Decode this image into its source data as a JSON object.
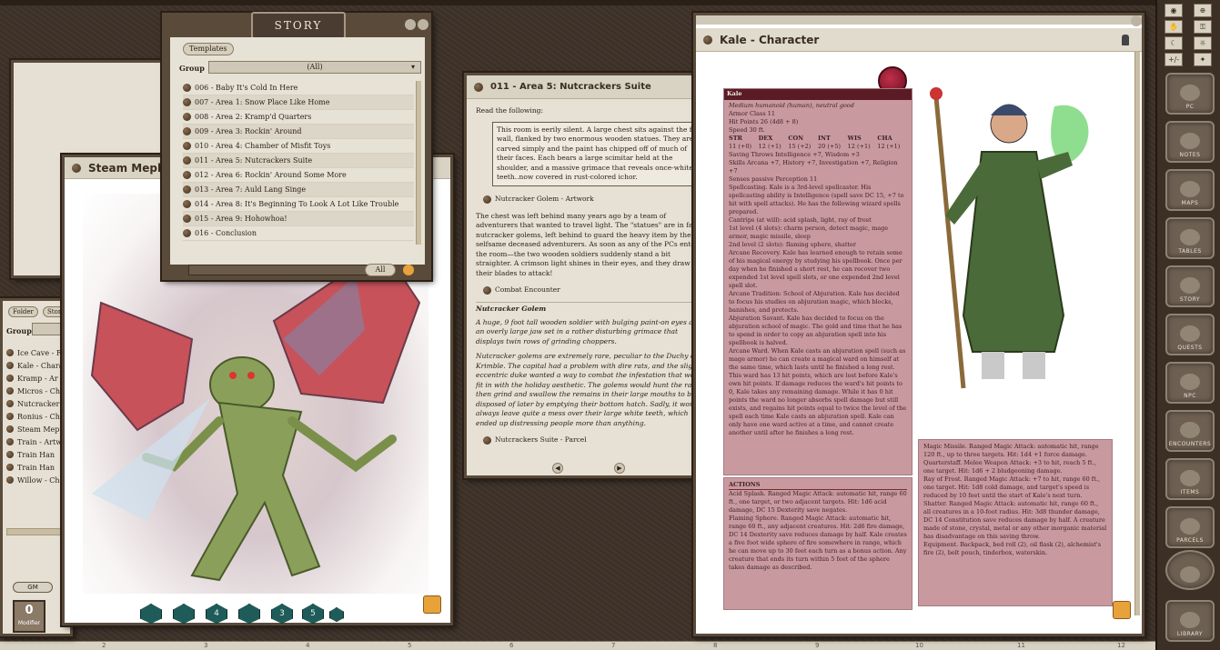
{
  "story": {
    "title": "STORY",
    "templates_label": "Templates",
    "group_label": "Group",
    "group_value": "(All)",
    "items": [
      "006 - Baby It's Cold In Here",
      "007 - Area 1: Snow Place Like Home",
      "008 - Area 2: Kramp'd Quarters",
      "009 - Area 3: Rockin' Around",
      "010 - Area 4: Chamber of Misfit Toys",
      "011 - Area 5: Nutcrackers Suite",
      "012 - Area 6: Rockin' Around Some More",
      "013 - Area 7: Auld Lang Singe",
      "014 - Area 8: It's Beginning To Look A Lot Like Trouble",
      "015 - Area 9: Hohowhoa!",
      "016 - Conclusion"
    ],
    "all_button": "All"
  },
  "mephit": {
    "title": "Steam Mephit"
  },
  "left_list": {
    "folder_tab": "Folder",
    "store_tab": "Store",
    "group_label": "Group",
    "items": [
      "Ice Cave - R",
      "Kale - Chara",
      "Kramp - Ar",
      "Micros - Ch",
      "Nutcracker",
      "Ronius - Ch",
      "Steam Mep",
      "Train - Artw",
      "Train Han",
      "Train Han",
      "Willow - Ch"
    ],
    "gm_label": "GM",
    "modifier_value": "0",
    "modifier_label": "Modifier"
  },
  "dice": [
    "",
    "",
    "4",
    "",
    "3",
    "5",
    ""
  ],
  "area5": {
    "title": "011 - Area 5: Nutcrackers Suite",
    "read": "Read the following:",
    "boxed": "This room is eerily silent. A large chest sits against the far wall, flanked by two enormous wooden statues. They are carved simply and the paint has chipped off of much of their faces. Each bears a large scimitar held at the shoulder, and a massive grimace that reveals once-white teeth..now covered in rust-colored ichor.",
    "link1": "Nutcracker Golem - Artwork",
    "para1": "The chest was left behind many years ago by a team of adventurers that wanted to travel light. The \"statues\" are in fact nutcracker golems, left behind to guard the heavy item by the selfsame deceased adventurers. As soon as any of the PCs enter the room—the two wooden soldiers suddenly stand a bit straighter. A crimson light shines in their eyes, and they draw their blades to attack!",
    "link2": "Combat Encounter",
    "heading": "Nutcracker Golem",
    "para2": "A huge, 9 foot tall wooden soldier with bulging paint-on eyes and an overly large jaw set in a rather disturbing grimace that displays twin rows of grinding choppers.",
    "para3": "Nutcracker golems are extremely rare, peculiar to the Duchy of Krimble. The capital had a problem with dire rats, and the slightly eccentric duke wanted a way to combat the infestation that would fit in with the holiday aesthetic. The golems would hunt the rats, then grind and swallow the remains in their large mouths to be disposed of later by emptying their bottom hatch. Sadly, it would always leave quite a mess over their large white teeth, which ended up distressing people more than anything.",
    "link3": "Nutcrackers Suite - Parcel"
  },
  "kale": {
    "title": "Kale - Character",
    "name": "Kale",
    "type": "Medium humanoid (human), neutral good",
    "ac": "Armor Class 11",
    "hp": "Hit Points 26 (4d8 + 8)",
    "speed": "Speed 30 ft.",
    "abilities": [
      "STR",
      "DEX",
      "CON",
      "INT",
      "WIS",
      "CHA"
    ],
    "scores": [
      "11 (+0)",
      "12 (+1)",
      "15 (+2)",
      "20 (+5)",
      "12 (+1)",
      "12 (+1)"
    ],
    "saves": "Saving Throws Intelligence +7, Wisdom +3",
    "skills": "Skills Arcana +7, History +7, Investigation +7, Religion +7",
    "senses": "Senses passive Perception 11",
    "spellcasting": "Spellcasting. Kale is a 3rd-level spellcaster. His spellcasting ability is Intelligence (spell save DC 15, +7 to hit with spell attacks). He has the following wizard spells prepared.",
    "cantrips": "Cantrips (at will): acid splash, light, ray of frost",
    "first": "1st level (4 slots): charm person, detect magic, mage armor, magic missile, sleep",
    "second": "2nd level (2 slots): flaming sphere, shatter",
    "recovery": "Arcane Recovery. Kale has learned enough to retain some of his magical energy by studying his spellbook. Once per day when he finished a short rest, he can recover two expended 1st level spell slots, or one expended 2nd level spell slot.",
    "tradition": "Arcane Tradition: School of Abjuration. Kale has decided to focus his studies on abjuration magic, which blocks, banishes, and protects.",
    "savant": "Abjuration Savant. Kale has decided to focus on the abjuration school of magic. The gold and time that he has to spend in order to copy an abjuration spell into his spellbook is halved.",
    "ward": "Arcane Ward. When Kale casts an abjuration spell (such as mage armor) he can create a magical ward on himself at the same time, which lasts until he finished a long rest. This ward has 13 hit points, which are lost before Kale's own hit points. If damage reduces the ward's hit points to 0, Kale takes any remaining damage. While it has 0 hit points the ward no longer absorbs spell damage but still exists, and regains hit points equal to twice the level of the spell each time Kale casts an abjuration spell. Kale can only have one ward active at a time, and cannot create another until after he finishes a long rest.",
    "actions": "ACTIONS",
    "acid": "Acid Splash. Ranged Magic Attack: automatic hit, range 60 ft., one target, or two adjacent targets. Hit: 1d6 acid damage, DC 15 Dexterity save negates.",
    "flaming": "Flaming Sphere. Ranged Magic Attack: automatic hit, range 60 ft., any adjacent creatures. Hit: 2d6 fire damage, DC 14 Dexterity save reduces damage by half. Kale creates a five foot wide sphere of fire somewhere in range, which he can move up to 30 feet each turn as a bonus action. Any creature that ends its turn within 5 feet of the sphere takes damage as described.",
    "missile": "Magic Missile. Ranged Magic Attack: automatic hit, range 120 ft., up to three targets. Hit: 1d4 +1 force damage.",
    "quarterstaff": "Quarterstaff. Melee Weapon Attack: +3 to hit, reach 5 ft., one target. Hit: 1d6 + 2 bludgeoning damage.",
    "frost": "Ray of Frost. Ranged Magic Attack: +7 to hit, range 60 ft., one target. Hit: 1d8 cold damage, and target's speed is reduced by 10 feet until the start of Kale's next turn.",
    "shatter": "Shatter. Ranged Magic Attack: automatic hit, range 60 ft., all creatures in a 10-foot radius. Hit: 3d8 thunder damage, DC 14 Constitution save reduces damage by half. A creature made of stone, crystal, metal or any other inorganic material has disadvantage on this saving throw.",
    "equipment": "Equipment. Backpack, bed roll (2), oil flask (2), alchemist's fire (2), belt pouch, tinderbox, waterskin."
  },
  "sidebar": [
    "PC",
    "NOTES",
    "MAPS",
    "TABLES",
    "STORY",
    "QUESTS",
    "NPC",
    "ENCOUNTERS",
    "ITEMS",
    "PARCELS",
    "",
    "LIBRARY"
  ],
  "tools": [
    "+/-"
  ],
  "ruler": [
    "2",
    "3",
    "4",
    "5",
    "6",
    "7",
    "8",
    "9",
    "10",
    "11",
    "12"
  ]
}
